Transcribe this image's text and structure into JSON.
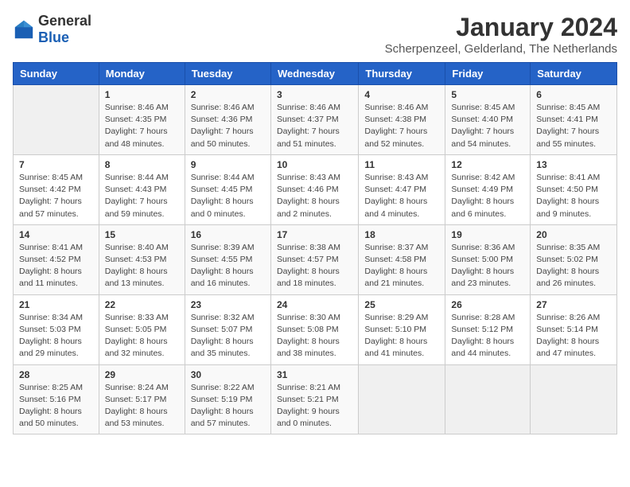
{
  "header": {
    "logo": {
      "general": "General",
      "blue": "Blue"
    },
    "title": "January 2024",
    "subtitle": "Scherpenzeel, Gelderland, The Netherlands"
  },
  "days_of_week": [
    "Sunday",
    "Monday",
    "Tuesday",
    "Wednesday",
    "Thursday",
    "Friday",
    "Saturday"
  ],
  "weeks": [
    [
      {
        "day": "",
        "sunrise": "",
        "sunset": "",
        "daylight": "",
        "empty": true
      },
      {
        "day": "1",
        "sunrise": "Sunrise: 8:46 AM",
        "sunset": "Sunset: 4:35 PM",
        "daylight": "Daylight: 7 hours and 48 minutes."
      },
      {
        "day": "2",
        "sunrise": "Sunrise: 8:46 AM",
        "sunset": "Sunset: 4:36 PM",
        "daylight": "Daylight: 7 hours and 50 minutes."
      },
      {
        "day": "3",
        "sunrise": "Sunrise: 8:46 AM",
        "sunset": "Sunset: 4:37 PM",
        "daylight": "Daylight: 7 hours and 51 minutes."
      },
      {
        "day": "4",
        "sunrise": "Sunrise: 8:46 AM",
        "sunset": "Sunset: 4:38 PM",
        "daylight": "Daylight: 7 hours and 52 minutes."
      },
      {
        "day": "5",
        "sunrise": "Sunrise: 8:45 AM",
        "sunset": "Sunset: 4:40 PM",
        "daylight": "Daylight: 7 hours and 54 minutes."
      },
      {
        "day": "6",
        "sunrise": "Sunrise: 8:45 AM",
        "sunset": "Sunset: 4:41 PM",
        "daylight": "Daylight: 7 hours and 55 minutes."
      }
    ],
    [
      {
        "day": "7",
        "sunrise": "Sunrise: 8:45 AM",
        "sunset": "Sunset: 4:42 PM",
        "daylight": "Daylight: 7 hours and 57 minutes."
      },
      {
        "day": "8",
        "sunrise": "Sunrise: 8:44 AM",
        "sunset": "Sunset: 4:43 PM",
        "daylight": "Daylight: 7 hours and 59 minutes."
      },
      {
        "day": "9",
        "sunrise": "Sunrise: 8:44 AM",
        "sunset": "Sunset: 4:45 PM",
        "daylight": "Daylight: 8 hours and 0 minutes."
      },
      {
        "day": "10",
        "sunrise": "Sunrise: 8:43 AM",
        "sunset": "Sunset: 4:46 PM",
        "daylight": "Daylight: 8 hours and 2 minutes."
      },
      {
        "day": "11",
        "sunrise": "Sunrise: 8:43 AM",
        "sunset": "Sunset: 4:47 PM",
        "daylight": "Daylight: 8 hours and 4 minutes."
      },
      {
        "day": "12",
        "sunrise": "Sunrise: 8:42 AM",
        "sunset": "Sunset: 4:49 PM",
        "daylight": "Daylight: 8 hours and 6 minutes."
      },
      {
        "day": "13",
        "sunrise": "Sunrise: 8:41 AM",
        "sunset": "Sunset: 4:50 PM",
        "daylight": "Daylight: 8 hours and 9 minutes."
      }
    ],
    [
      {
        "day": "14",
        "sunrise": "Sunrise: 8:41 AM",
        "sunset": "Sunset: 4:52 PM",
        "daylight": "Daylight: 8 hours and 11 minutes."
      },
      {
        "day": "15",
        "sunrise": "Sunrise: 8:40 AM",
        "sunset": "Sunset: 4:53 PM",
        "daylight": "Daylight: 8 hours and 13 minutes."
      },
      {
        "day": "16",
        "sunrise": "Sunrise: 8:39 AM",
        "sunset": "Sunset: 4:55 PM",
        "daylight": "Daylight: 8 hours and 16 minutes."
      },
      {
        "day": "17",
        "sunrise": "Sunrise: 8:38 AM",
        "sunset": "Sunset: 4:57 PM",
        "daylight": "Daylight: 8 hours and 18 minutes."
      },
      {
        "day": "18",
        "sunrise": "Sunrise: 8:37 AM",
        "sunset": "Sunset: 4:58 PM",
        "daylight": "Daylight: 8 hours and 21 minutes."
      },
      {
        "day": "19",
        "sunrise": "Sunrise: 8:36 AM",
        "sunset": "Sunset: 5:00 PM",
        "daylight": "Daylight: 8 hours and 23 minutes."
      },
      {
        "day": "20",
        "sunrise": "Sunrise: 8:35 AM",
        "sunset": "Sunset: 5:02 PM",
        "daylight": "Daylight: 8 hours and 26 minutes."
      }
    ],
    [
      {
        "day": "21",
        "sunrise": "Sunrise: 8:34 AM",
        "sunset": "Sunset: 5:03 PM",
        "daylight": "Daylight: 8 hours and 29 minutes."
      },
      {
        "day": "22",
        "sunrise": "Sunrise: 8:33 AM",
        "sunset": "Sunset: 5:05 PM",
        "daylight": "Daylight: 8 hours and 32 minutes."
      },
      {
        "day": "23",
        "sunrise": "Sunrise: 8:32 AM",
        "sunset": "Sunset: 5:07 PM",
        "daylight": "Daylight: 8 hours and 35 minutes."
      },
      {
        "day": "24",
        "sunrise": "Sunrise: 8:30 AM",
        "sunset": "Sunset: 5:08 PM",
        "daylight": "Daylight: 8 hours and 38 minutes."
      },
      {
        "day": "25",
        "sunrise": "Sunrise: 8:29 AM",
        "sunset": "Sunset: 5:10 PM",
        "daylight": "Daylight: 8 hours and 41 minutes."
      },
      {
        "day": "26",
        "sunrise": "Sunrise: 8:28 AM",
        "sunset": "Sunset: 5:12 PM",
        "daylight": "Daylight: 8 hours and 44 minutes."
      },
      {
        "day": "27",
        "sunrise": "Sunrise: 8:26 AM",
        "sunset": "Sunset: 5:14 PM",
        "daylight": "Daylight: 8 hours and 47 minutes."
      }
    ],
    [
      {
        "day": "28",
        "sunrise": "Sunrise: 8:25 AM",
        "sunset": "Sunset: 5:16 PM",
        "daylight": "Daylight: 8 hours and 50 minutes."
      },
      {
        "day": "29",
        "sunrise": "Sunrise: 8:24 AM",
        "sunset": "Sunset: 5:17 PM",
        "daylight": "Daylight: 8 hours and 53 minutes."
      },
      {
        "day": "30",
        "sunrise": "Sunrise: 8:22 AM",
        "sunset": "Sunset: 5:19 PM",
        "daylight": "Daylight: 8 hours and 57 minutes."
      },
      {
        "day": "31",
        "sunrise": "Sunrise: 8:21 AM",
        "sunset": "Sunset: 5:21 PM",
        "daylight": "Daylight: 9 hours and 0 minutes."
      },
      {
        "day": "",
        "sunrise": "",
        "sunset": "",
        "daylight": "",
        "empty": true
      },
      {
        "day": "",
        "sunrise": "",
        "sunset": "",
        "daylight": "",
        "empty": true
      },
      {
        "day": "",
        "sunrise": "",
        "sunset": "",
        "daylight": "",
        "empty": true
      }
    ]
  ]
}
